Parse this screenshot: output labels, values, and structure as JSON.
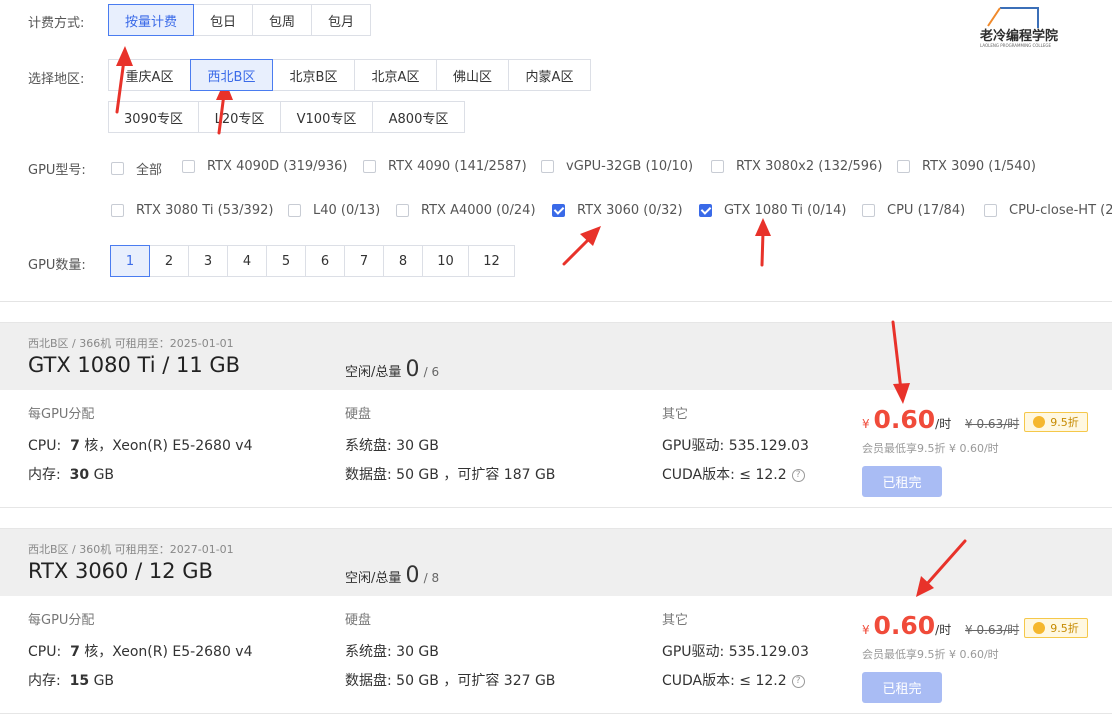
{
  "billing": {
    "label": "计费方式:",
    "options": [
      "按量计费",
      "包日",
      "包周",
      "包月"
    ]
  },
  "region": {
    "label": "选择地区:",
    "options_row1": [
      "重庆A区",
      "西北B区",
      "北京B区",
      "北京A区",
      "佛山区",
      "内蒙A区"
    ],
    "options_row2": [
      "3090专区",
      "L20专区",
      "V100专区",
      "A800专区"
    ]
  },
  "gpu_model": {
    "label": "GPU型号:",
    "row1": [
      "全部",
      "RTX 4090D (319/936)",
      "RTX 4090 (141/2587)",
      "vGPU-32GB (10/10)",
      "RTX 3080x2 (132/596)",
      "RTX 3090 (1/540)"
    ],
    "row2": [
      "RTX 3080 Ti (53/392)",
      "L40 (0/13)",
      "RTX A4000 (0/24)",
      "RTX 3060 (0/32)",
      "GTX 1080 Ti (0/14)",
      "CPU (17/84)",
      "CPU-close-HT (2"
    ]
  },
  "gpu_count": {
    "label": "GPU数量:",
    "options": [
      "1",
      "2",
      "3",
      "4",
      "5",
      "6",
      "7",
      "8",
      "10",
      "12"
    ]
  },
  "logo": {
    "text": "老冷编程学院",
    "subtext": "LAOLENG PROGRAMMING COLLEGE"
  },
  "machines": [
    {
      "meta": "西北B区 / 366机   可租用至：2025-01-01",
      "title": "GTX 1080 Ti / 11 GB",
      "free_label": "空闲/总量",
      "free": "0",
      "total": "/ 6",
      "col1_head": "每GPU分配",
      "col2_head": "硬盘",
      "col3_head": "其它",
      "cpu_label": "CPU:",
      "cpu_cores": "7",
      "cpu_rest": "核，Xeon(R) E5-2680 v4",
      "mem_label": "内存:",
      "mem_value": "30",
      "mem_unit": "GB",
      "sys_disk": "系统盘:  30 GB",
      "data_disk": "数据盘:  50 GB ，可扩容 187 GB",
      "driver": "GPU驱动:  535.129.03",
      "cuda": "CUDA版本:  ≤ 12.2",
      "yen": "¥",
      "price": "0.60",
      "unit": "/时",
      "old_price": "¥ 0.63/时",
      "discount": "9.5折",
      "member": "会员最低享9.5折 ¥ 0.60/时",
      "button": "已租完"
    },
    {
      "meta": "西北B区 / 360机   可租用至：2027-01-01",
      "title": "RTX 3060 / 12 GB",
      "free_label": "空闲/总量",
      "free": "0",
      "total": "/ 8",
      "col1_head": "每GPU分配",
      "col2_head": "硬盘",
      "col3_head": "其它",
      "cpu_label": "CPU:",
      "cpu_cores": "7",
      "cpu_rest": "核，Xeon(R) E5-2680 v4",
      "mem_label": "内存:",
      "mem_value": "15",
      "mem_unit": "GB",
      "sys_disk": "系统盘:  30 GB",
      "data_disk": "数据盘:  50 GB ，可扩容 327 GB",
      "driver": "GPU驱动:  535.129.03",
      "cuda": "CUDA版本:  ≤ 12.2",
      "yen": "¥",
      "price": "0.60",
      "unit": "/时",
      "old_price": "¥ 0.63/时",
      "discount": "9.5折",
      "member": "会员最低享9.5折 ¥ 0.60/时",
      "button": "已租完"
    }
  ],
  "colors": {
    "accent": "#3a6ae8",
    "price": "#f04b3a",
    "annotation_arrow": "#e8322a"
  }
}
